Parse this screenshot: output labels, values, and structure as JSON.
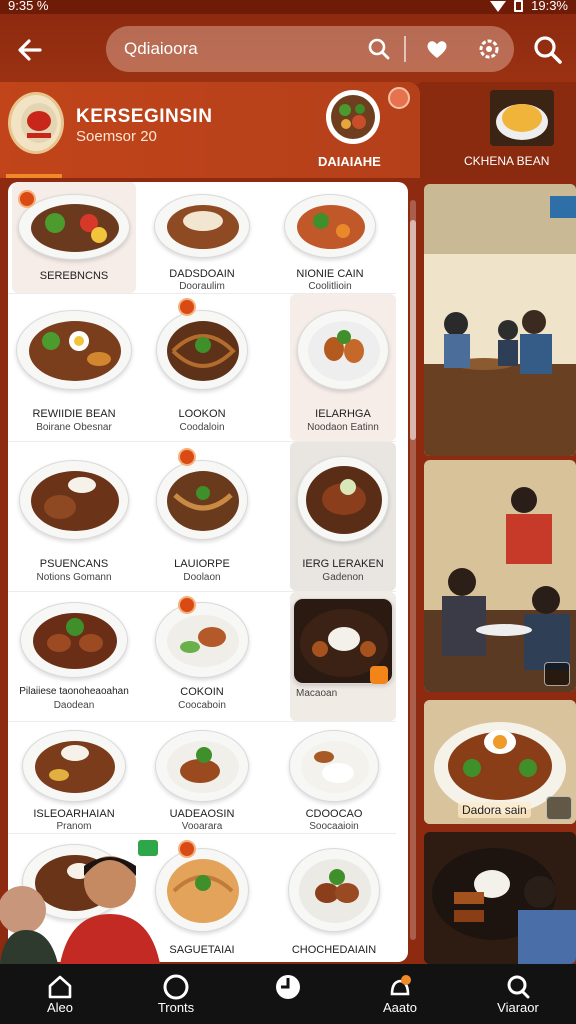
{
  "status_bar": {
    "time": "9:35 %",
    "battery": "19:3%"
  },
  "app_bar": {
    "search_text": "Qdiaioora"
  },
  "store": {
    "name": "KERSEGINSIN",
    "subtitle": "Soemsor 20",
    "tab_label": "DAIAIAHE",
    "side_label": "CKHENA BEAN"
  },
  "dishes": [
    [
      {
        "name": "SEREBNCNS",
        "sub": ""
      },
      {
        "name": "DADSDOAIN",
        "sub": "Dooraulim"
      },
      {
        "name": "NIONIE CAIN",
        "sub": "Coolitlioin"
      }
    ],
    [
      {
        "name": "REWIIDIE BEAN",
        "sub": "Boirane Obesnar"
      },
      {
        "name": "LOOKON",
        "sub": "Coodaloin"
      },
      {
        "name": "IELARHGA",
        "sub": "Noodaon Eatinn"
      }
    ],
    [
      {
        "name": "PSUENCANS",
        "sub": "Notions Gomann"
      },
      {
        "name": "LAUIORPE",
        "sub": "Doolaon"
      },
      {
        "name": "IERG LERAKEN",
        "sub": "Gadenon"
      }
    ],
    [
      {
        "name": "Pilaiiese taonoheaoahan",
        "sub": "Daodean"
      },
      {
        "name": "COKOIN",
        "sub": "Coocaboin"
      },
      {
        "name": "",
        "sub": "Macaoan"
      }
    ],
    [
      {
        "name": "ISLEOARHAIAN",
        "sub": "Pranom"
      },
      {
        "name": "UADEAOSIN",
        "sub": "Vooarara"
      },
      {
        "name": "CDOOCAO",
        "sub": "Soocaaioin"
      }
    ],
    [
      {
        "name": "",
        "sub": ""
      },
      {
        "name": "SAGUETAIAI",
        "sub": ""
      },
      {
        "name": "CHOCHEDAIAIN",
        "sub": ""
      }
    ]
  ],
  "photos": {
    "right_label": "Dadora sain"
  },
  "bottom_nav": [
    {
      "label": "Aleo"
    },
    {
      "label": "Tronts"
    },
    {
      "label": ""
    },
    {
      "label": "Aaato"
    },
    {
      "label": "Viaraor"
    }
  ],
  "colors": {
    "primary": "#9b3212",
    "accent": "#f08a28",
    "nav_bg": "#121212"
  }
}
